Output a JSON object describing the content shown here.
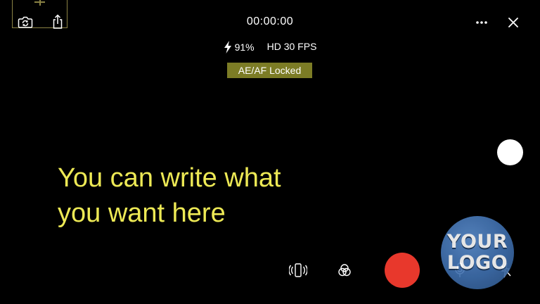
{
  "header": {
    "timecode": "00:00:00"
  },
  "status": {
    "battery": "91%",
    "format": "HD 30 FPS",
    "lock_badge": "AE/AF Locked"
  },
  "overlay": {
    "line1": "You can write what",
    "line2": "you want here"
  },
  "logo": {
    "line1": "YOUR",
    "line2": "LOGO"
  },
  "colors": {
    "record": "#e8382c",
    "overlay_text": "#ede955",
    "lock_badge": "#7c7c25",
    "logo": "#4a7bbf"
  },
  "icons": {
    "top_left": [
      "switch-camera-icon",
      "share-icon"
    ],
    "top_right": [
      "more-icon",
      "close-icon"
    ],
    "bottom": [
      "stabilization-icon",
      "color-filter-icon",
      "microphone-icon",
      "flash-off-icon"
    ]
  }
}
